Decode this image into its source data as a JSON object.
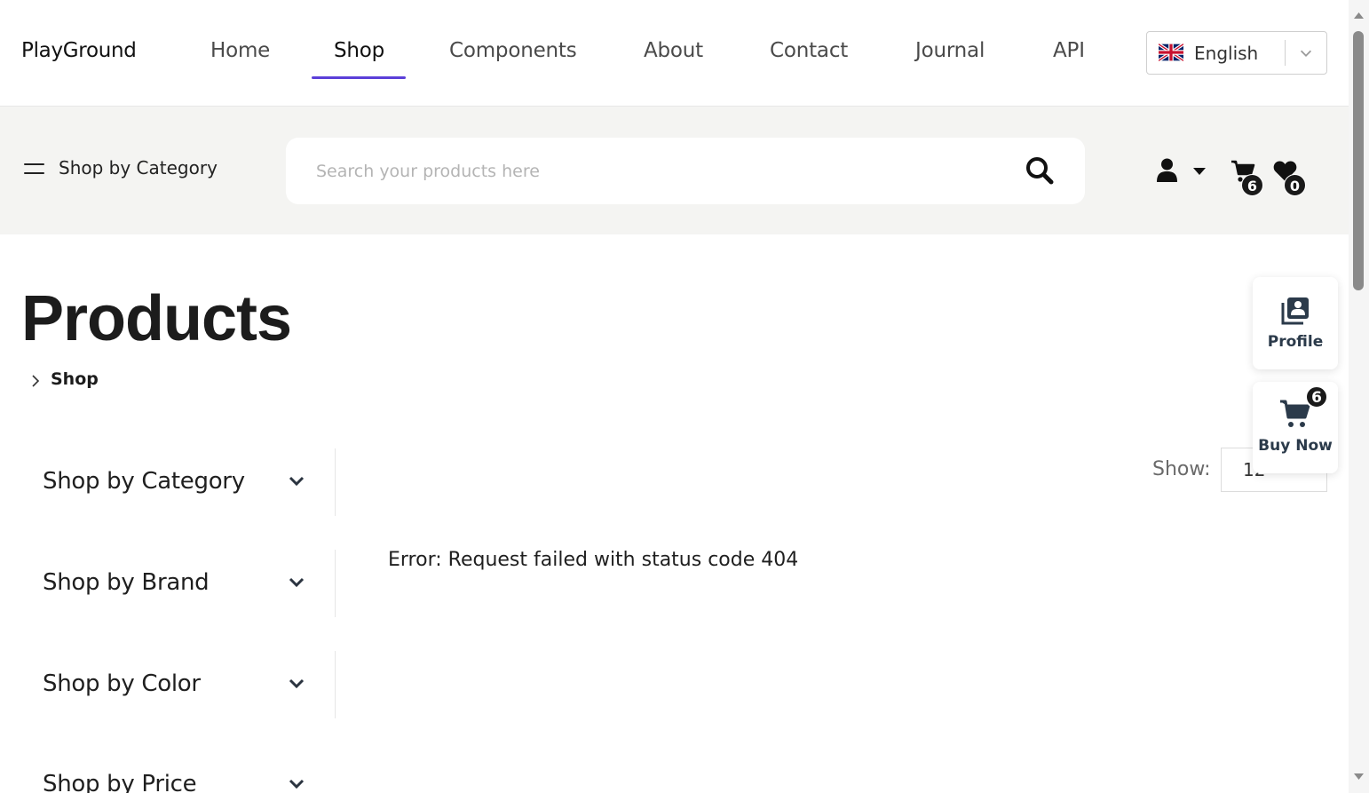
{
  "header": {
    "brand": "PlayGround",
    "nav": [
      {
        "label": "Home"
      },
      {
        "label": "Shop"
      },
      {
        "label": "Components"
      },
      {
        "label": "About"
      },
      {
        "label": "Contact"
      },
      {
        "label": "Journal"
      },
      {
        "label": "API"
      }
    ],
    "active_nav": "Shop",
    "language": {
      "label": "English",
      "flag_icon": "uk-flag-icon"
    }
  },
  "toolbar": {
    "category_toggle_label": "Shop by Category",
    "search_placeholder": "Search your products here",
    "cart_count": "6",
    "wishlist_count": "0"
  },
  "page": {
    "title": "Products",
    "breadcrumb": "Shop"
  },
  "filters": [
    {
      "label": "Shop by Category"
    },
    {
      "label": "Shop by Brand"
    },
    {
      "label": "Shop by Color"
    },
    {
      "label": "Shop by Price"
    }
  ],
  "listing": {
    "show_label": "Show:",
    "show_value": "12",
    "error": "Error: Request failed with status code 404"
  },
  "floating": {
    "profile_label": "Profile",
    "buy_label": "Buy Now",
    "buy_count": "6"
  },
  "colors": {
    "accent": "#5b3fd9",
    "band_bg": "#f4f4f2",
    "text": "#1f1f1f"
  }
}
